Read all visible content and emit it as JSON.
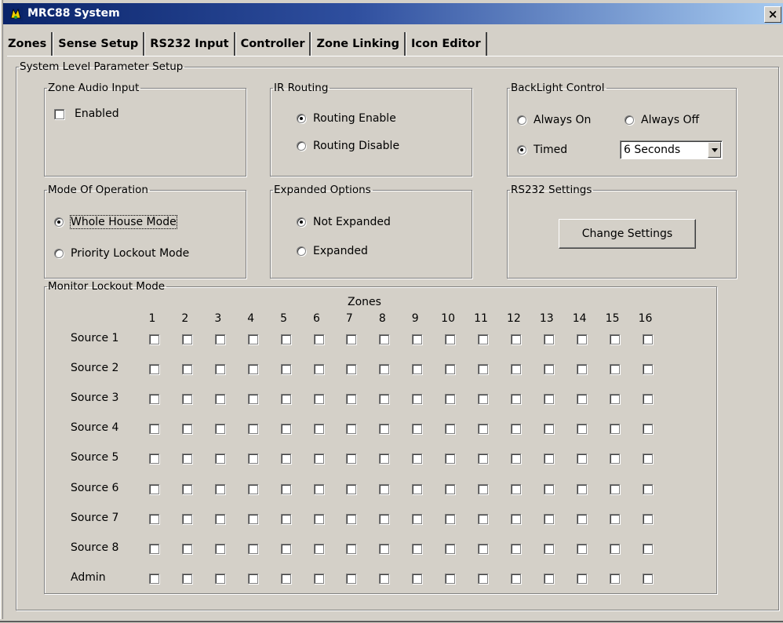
{
  "window": {
    "title": "MRC88 System",
    "close_label": "×"
  },
  "tabs": [
    {
      "label": "Zones",
      "active": false
    },
    {
      "label": "Sense Setup",
      "active": false
    },
    {
      "label": "RS232 Input",
      "active": false
    },
    {
      "label": "Controller",
      "active": true
    },
    {
      "label": "Zone Linking",
      "active": false
    },
    {
      "label": "Icon Editor",
      "active": false
    }
  ],
  "system_group": {
    "title": "System Level Parameter Setup"
  },
  "zone_audio_input": {
    "title": "Zone Audio Input",
    "enabled_label": "Enabled",
    "enabled_checked": false
  },
  "ir_routing": {
    "title": "IR Routing",
    "options": [
      {
        "label": "Routing Enable",
        "selected": true
      },
      {
        "label": "Routing Disable",
        "selected": false
      }
    ]
  },
  "backlight": {
    "title": "BackLight Control",
    "always_on_label": "Always On",
    "always_off_label": "Always Off",
    "timed_label": "Timed",
    "selected": "Timed",
    "timed_value": "6 Seconds"
  },
  "mode_of_operation": {
    "title": "Mode Of Operation",
    "options": [
      {
        "label": "Whole House Mode",
        "selected": true
      },
      {
        "label": "Priority Lockout Mode",
        "selected": false
      }
    ]
  },
  "expanded_options": {
    "title": "Expanded Options",
    "options": [
      {
        "label": "Not Expanded",
        "selected": true
      },
      {
        "label": "Expanded",
        "selected": false
      }
    ]
  },
  "rs232_settings": {
    "title": "RS232 Settings",
    "button_label": "Change Settings"
  },
  "monitor_lockout": {
    "title": "Monitor Lockout Mode",
    "zones_label": "Zones",
    "zones": [
      "1",
      "2",
      "3",
      "4",
      "5",
      "6",
      "7",
      "8",
      "9",
      "10",
      "11",
      "12",
      "13",
      "14",
      "15",
      "16"
    ],
    "sources": [
      "Source 1",
      "Source 2",
      "Source 3",
      "Source 4",
      "Source 5",
      "Source 6",
      "Source 7",
      "Source 8",
      "Admin"
    ]
  }
}
